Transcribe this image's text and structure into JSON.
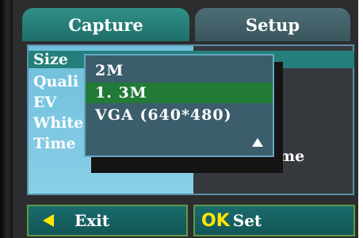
{
  "tabs": [
    {
      "label": "Capture",
      "active": true
    },
    {
      "label": "Setup",
      "active": false
    }
  ],
  "menu": {
    "items": [
      {
        "label": "Size",
        "selected": true
      },
      {
        "label": "Quali",
        "selected": false
      },
      {
        "label": "EV",
        "selected": false
      },
      {
        "label": "White",
        "selected": false
      },
      {
        "label": "Time",
        "selected": false
      }
    ],
    "right_value": "me"
  },
  "dropdown": {
    "options": [
      {
        "label": "2M",
        "selected": false
      },
      {
        "label": "1. 3M",
        "selected": true
      },
      {
        "label": "VGA (640*480)",
        "selected": false
      }
    ],
    "scroll_icon": "triangle-up-icon"
  },
  "buttons": {
    "exit_label": "Exit",
    "ok_label": "OK",
    "set_label": "Set"
  },
  "colors": {
    "accent_yellow": "#ffe600",
    "selection_teal": "#247f7c",
    "selection_green": "#217a35"
  }
}
